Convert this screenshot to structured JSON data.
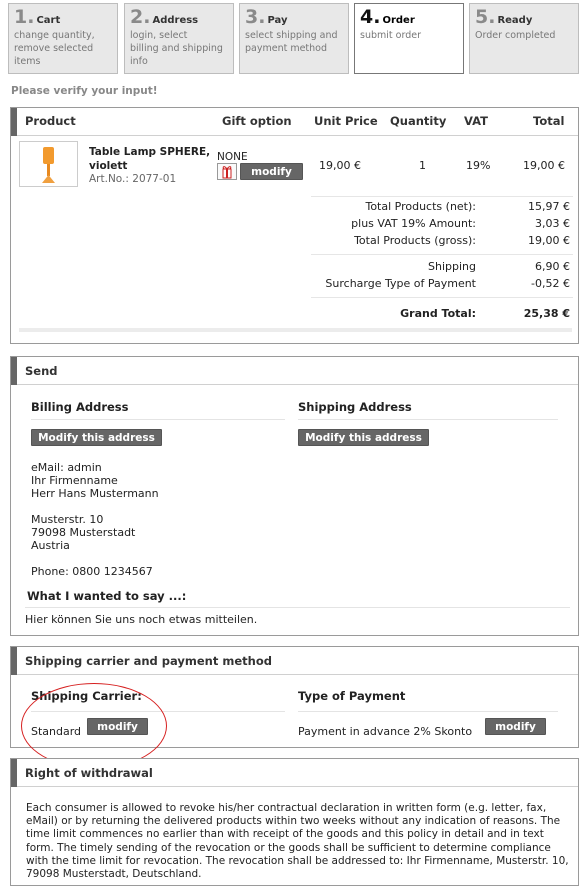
{
  "steps": [
    {
      "num": "1.",
      "title": "Cart",
      "desc": [
        "change quantity,",
        "remove selected",
        "items"
      ]
    },
    {
      "num": "2.",
      "title": "Address",
      "desc": [
        "login, select",
        "billing and shipping",
        "info"
      ]
    },
    {
      "num": "3.",
      "title": "Pay",
      "desc": [
        "select shipping and",
        "payment method",
        ""
      ]
    },
    {
      "num": "4.",
      "title": "Order",
      "desc": [
        "submit order",
        "",
        ""
      ]
    },
    {
      "num": "5.",
      "title": "Ready",
      "desc": [
        "Order completed",
        "",
        ""
      ]
    }
  ],
  "verify_text": "Please verify your input!",
  "cart": {
    "headers": {
      "product": "Product",
      "gift": "Gift option",
      "unit_price": "Unit Price",
      "quantity": "Quantity",
      "vat": "VAT",
      "total": "Total"
    },
    "item": {
      "name_line1": "Table Lamp SPHERE,",
      "name_line2": "violett",
      "art_no": "Art.No.: 2077-01",
      "gift_option": "NONE",
      "gift_modify": "modify",
      "unit_price": "19,00 €",
      "quantity": "1",
      "vat": "19%",
      "total": "19,00 €"
    },
    "summary": [
      {
        "label": "Total Products (net):",
        "value": "15,97 €"
      },
      {
        "label": "plus VAT 19% Amount:",
        "value": "3,03 €"
      },
      {
        "label": "Total Products (gross):",
        "value": "19,00 €"
      },
      {
        "label": "Shipping",
        "value": "6,90 €"
      },
      {
        "label": "Surcharge Type of Payment",
        "value": "-0,52 €"
      }
    ],
    "grand_total_label": "Grand Total:",
    "grand_total_value": "25,38 €"
  },
  "send": {
    "title": "Send",
    "billing_title": "Billing Address",
    "shipping_title": "Shipping Address",
    "modify_address": "Modify this address",
    "address_lines": [
      "eMail: admin",
      "Ihr Firmenname",
      "Herr Hans Mustermann",
      "",
      "Musterstr. 10",
      "79098 Musterstadt",
      "Austria",
      "",
      "Phone: 0800 1234567"
    ],
    "wanted_title": "What I wanted to say ...:",
    "message": "Hier können Sie uns noch etwas mitteilen."
  },
  "shipping_payment": {
    "title": "Shipping carrier and payment method",
    "carrier_title": "Shipping Carrier:",
    "carrier_value": "Standard",
    "payment_title": "Type of Payment",
    "payment_value": "Payment in advance 2% Skonto",
    "modify": "modify"
  },
  "withdrawal": {
    "title": "Right of withdrawal",
    "text": "Each consumer is allowed to revoke his/her contractual declaration in written form (e.g. letter, fax, eMail) or by returning the delivered products within two weeks without any indication of reasons. The time limit commences no earlier than with receipt of the goods and this policy in detail and in text form. The timely sending of the revocation or the goods shall be sufficient to determine compliance with the time limit for revocation. The revocation shall be addressed to: Ihr Firmenname, Musterstr. 10, 79098 Musterstadt, Deutschland."
  },
  "colors": {
    "accent_bar": "#666666",
    "button_bg": "#666666",
    "annotation_red": "#d62020"
  }
}
